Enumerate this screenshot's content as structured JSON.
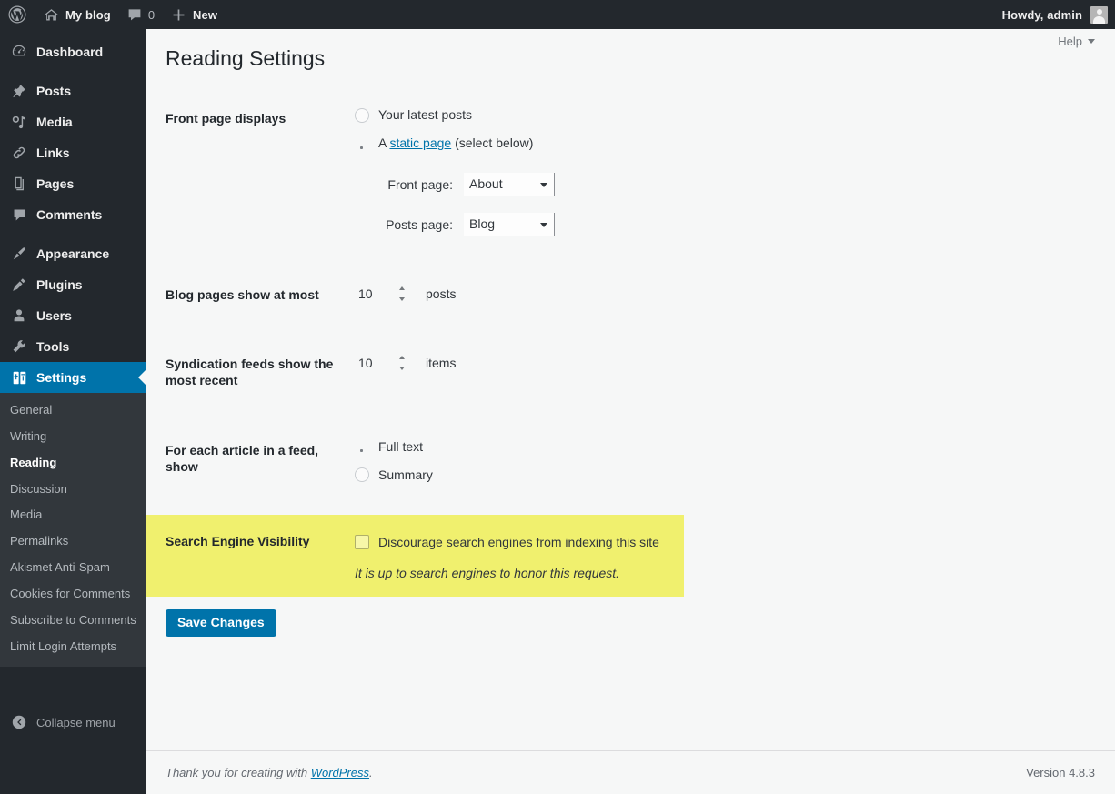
{
  "adminbar": {
    "logo_icon": "wordpress-logo-icon",
    "site_name": "My blog",
    "home_icon": "home-icon",
    "comments_icon": "comment-bubble-icon",
    "comment_count": "0",
    "new_icon": "plus-icon",
    "new_label": "New",
    "howdy": "Howdy, admin",
    "avatar_icon": "user-avatar-icon"
  },
  "sidebar": {
    "items": [
      {
        "label": "Dashboard",
        "icon": "dashboard-icon",
        "current": false
      },
      {
        "label": "Posts",
        "icon": "pin-icon",
        "current": false
      },
      {
        "label": "Media",
        "icon": "media-icon",
        "current": false
      },
      {
        "label": "Links",
        "icon": "link-icon",
        "current": false
      },
      {
        "label": "Pages",
        "icon": "pages-icon",
        "current": false
      },
      {
        "label": "Comments",
        "icon": "comment-bubble-icon",
        "current": false
      },
      {
        "label": "Appearance",
        "icon": "paintbrush-icon",
        "current": false
      },
      {
        "label": "Plugins",
        "icon": "plug-icon",
        "current": false
      },
      {
        "label": "Users",
        "icon": "user-icon",
        "current": false
      },
      {
        "label": "Tools",
        "icon": "wrench-icon",
        "current": false
      },
      {
        "label": "Settings",
        "icon": "settings-sliders-icon",
        "current": true
      }
    ],
    "submenu": [
      {
        "label": "General",
        "current": false
      },
      {
        "label": "Writing",
        "current": false
      },
      {
        "label": "Reading",
        "current": true
      },
      {
        "label": "Discussion",
        "current": false
      },
      {
        "label": "Media",
        "current": false
      },
      {
        "label": "Permalinks",
        "current": false
      },
      {
        "label": "Akismet Anti-Spam",
        "current": false
      },
      {
        "label": "Cookies for Comments",
        "current": false
      },
      {
        "label": "Subscribe to Comments",
        "current": false
      },
      {
        "label": "Limit Login Attempts",
        "current": false
      }
    ],
    "collapse_label": "Collapse menu",
    "collapse_icon": "chevron-left-circle-icon",
    "accent_color": "#0073aa",
    "background_color": "#23282d",
    "submenu_background_color": "#32373c"
  },
  "help_tab": {
    "label": "Help",
    "caret_icon": "chevron-down-icon"
  },
  "page": {
    "title": "Reading Settings"
  },
  "settings": {
    "front_page_displays": {
      "label": "Front page displays",
      "options": [
        {
          "text": "Your latest posts",
          "selected": false
        },
        {
          "text": "A static page (select below)",
          "selected": true,
          "prefix": "A ",
          "link": "static page",
          "suffix": " (select below)"
        }
      ],
      "selects": [
        {
          "label": "Front page:",
          "value": "About",
          "name": "front-page-select"
        },
        {
          "label": "Posts page:",
          "value": "Blog",
          "name": "posts-page-select"
        }
      ]
    },
    "blog_pages": {
      "label": "Blog pages show at most",
      "value": "10",
      "unit": "posts"
    },
    "syndication_feeds": {
      "label": "Syndication feeds show the most recent",
      "value": "10",
      "unit": "items"
    },
    "feed_article": {
      "label": "For each article in a feed, show",
      "options": [
        {
          "text": "Full text",
          "selected": true
        },
        {
          "text": "Summary",
          "selected": false
        }
      ]
    },
    "search_engine_visibility": {
      "label": "Search Engine Visibility",
      "checkbox_label": "Discourage search engines from indexing this site",
      "checked": false,
      "note": "It is up to search engines to honor this request.",
      "highlight_color": "#f0f06e"
    }
  },
  "submit": {
    "label": "Save Changes"
  },
  "footer": {
    "thanks_prefix": "Thank you for creating with ",
    "thanks_link": "WordPress",
    "thanks_suffix": ".",
    "version": "Version 4.8.3"
  }
}
